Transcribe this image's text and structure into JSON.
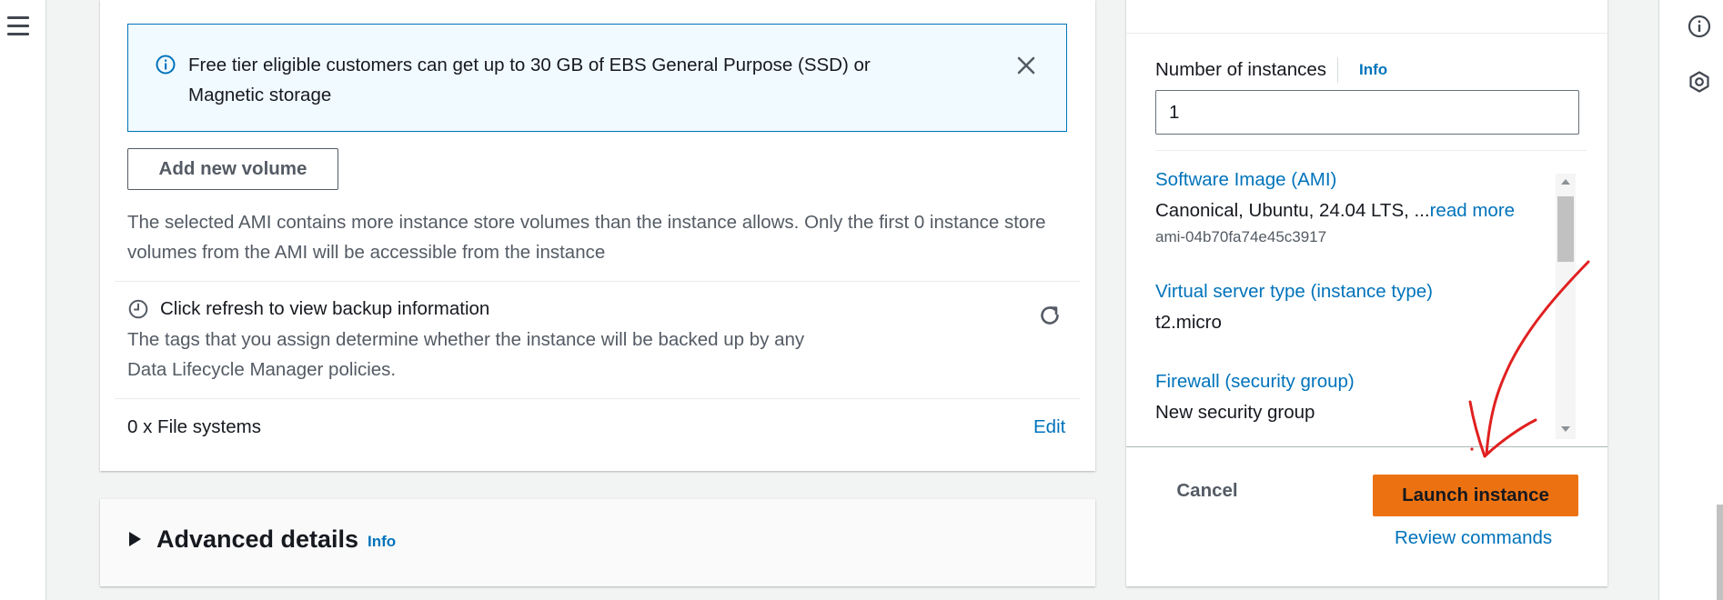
{
  "nav": {
    "menu_icon": "hamburger-menu-icon"
  },
  "storage": {
    "free_tier_notice": "Free tier eligible customers can get up to 30 GB of EBS General Purpose (SSD) or Magnetic storage",
    "add_volume_label": "Add new volume",
    "ami_warning": "The selected AMI contains more instance store volumes than the instance allows. Only the first 0 instance store volumes from the AMI will be accessible from the instance",
    "backup_title": "Click refresh to view backup information",
    "backup_desc": "The tags that you assign determine whether the instance will be backed up by any Data Lifecycle Manager policies.",
    "file_systems_label": "0 x File systems",
    "file_systems_edit": "Edit"
  },
  "advanced": {
    "title": "Advanced details",
    "info": "Info"
  },
  "summary": {
    "num_instances_label": "Number of instances",
    "num_instances_info": "Info",
    "num_instances_value": "1",
    "software_image_label": "Software Image (AMI)",
    "software_image_value": "Canonical, Ubuntu, 24.04 LTS, ...",
    "software_image_read_more": "read more",
    "software_image_id": "ami-04b70fa74e45c3917",
    "instance_type_label": "Virtual server type (instance type)",
    "instance_type_value": "t2.micro",
    "firewall_label": "Firewall (security group)",
    "firewall_value": "New security group",
    "cancel_label": "Cancel",
    "launch_label": "Launch instance",
    "review_commands": "Review commands"
  },
  "right_panel": {
    "icons": [
      "info-icon",
      "hexagon-settings-icon"
    ]
  },
  "colors": {
    "link": "#0073bb",
    "primary_button": "#ec7211",
    "info_banner_bg": "#f1faff",
    "info_banner_border": "#0073bb",
    "annotation": "#e02020"
  }
}
